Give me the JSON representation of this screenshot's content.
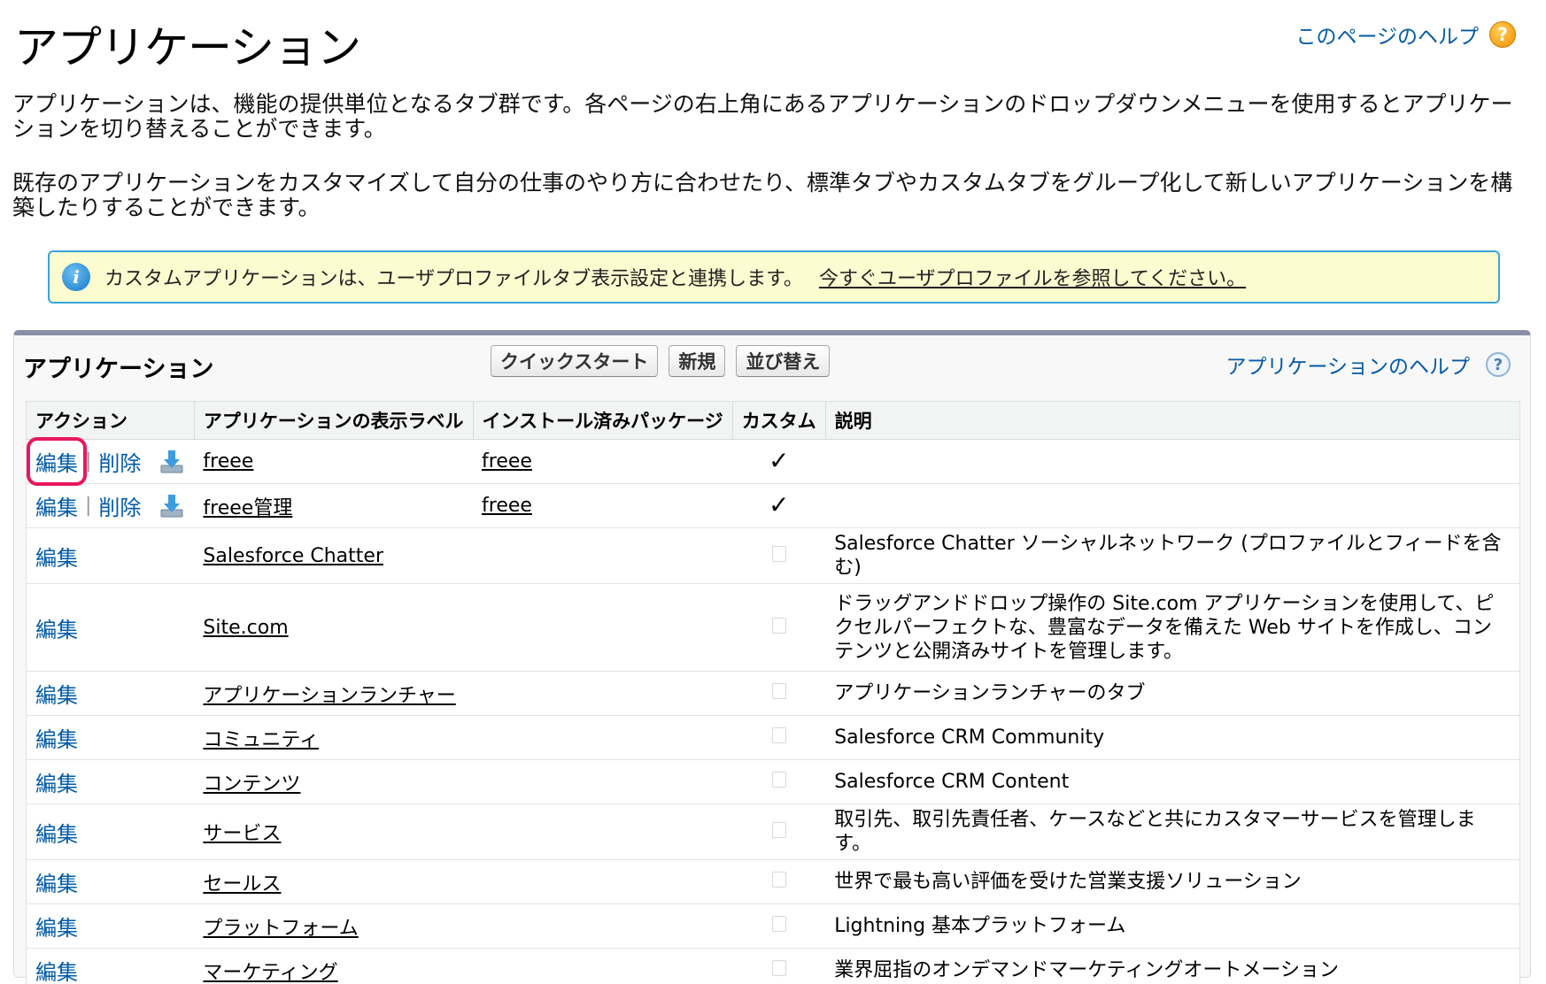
{
  "header": {
    "title": "アプリケーション",
    "help_link": "このページのヘルプ",
    "help_icon": "question-icon"
  },
  "intro": {
    "paragraph1": "アプリケーションは、機能の提供単位となるタブ群です。各ページの右上角にあるアプリケーションのドロップダウンメニューを使用するとアプリケーションを切り替えることができます。",
    "paragraph2": "既存のアプリケーションをカスタマイズして自分の仕事のやり方に合わせたり、標準タブやカスタムタブをグループ化して新しいアプリケーションを構築したりすることができます。"
  },
  "info_box": {
    "icon": "info-icon",
    "text": "カスタムアプリケーションは、ユーザプロファイルタブ表示設定と連携します。",
    "link": "今すぐユーザプロファイルを参照してください。"
  },
  "panel": {
    "title": "アプリケーション",
    "buttons": {
      "quickstart": "クイックスタート",
      "new": "新規",
      "reorder": "並び替え"
    },
    "help_link": "アプリケーションのヘルプ"
  },
  "table": {
    "headers": {
      "action": "アクション",
      "label": "アプリケーションの表示ラベル",
      "package": "インストール済みパッケージ",
      "custom": "カスタム",
      "description": "説明"
    },
    "action_labels": {
      "edit": "編集",
      "delete": "削除",
      "separator": "|"
    },
    "check_mark": "✓",
    "rows": [
      {
        "label": "freee",
        "package": "freee",
        "custom": true,
        "description": ""
      },
      {
        "label": "freee管理",
        "package": "freee",
        "custom": true,
        "description": ""
      },
      {
        "label": "Salesforce Chatter",
        "package": "",
        "custom": false,
        "description": "Salesforce Chatter ソーシャルネットワーク (プロファイルとフィードを含む)"
      },
      {
        "label": "Site.com",
        "package": "",
        "custom": false,
        "description": "ドラッグアンドドロップ操作の Site.com アプリケーションを使用して、ピクセルパーフェクトな、豊富なデータを備えた Web サイトを作成し、コンテンツと公開済みサイトを管理します。"
      },
      {
        "label": "アプリケーションランチャー",
        "package": "",
        "custom": false,
        "description": "アプリケーションランチャーのタブ"
      },
      {
        "label": "コミュニティ",
        "package": "",
        "custom": false,
        "description": "Salesforce CRM Community"
      },
      {
        "label": "コンテンツ",
        "package": "",
        "custom": false,
        "description": "Salesforce CRM Content"
      },
      {
        "label": "サービス",
        "package": "",
        "custom": false,
        "description": "取引先、取引先責任者、ケースなどと共にカスタマーサービスを管理します。"
      },
      {
        "label": "セールス",
        "package": "",
        "custom": false,
        "description": "世界で最も高い評価を受けた営業支援ソリューション"
      },
      {
        "label": "プラットフォーム",
        "package": "",
        "custom": false,
        "description": "Lightning 基本プラットフォーム"
      },
      {
        "label": "マーケティング",
        "package": "",
        "custom": false,
        "description": "業界屈指のオンデマンドマーケティングオートメーション"
      }
    ]
  },
  "colors": {
    "link": "#015ba7",
    "info_background": "#fdfbd0",
    "info_border": "#39a5dc",
    "highlight": "#e8175d",
    "panel_top": "#888fa6"
  }
}
